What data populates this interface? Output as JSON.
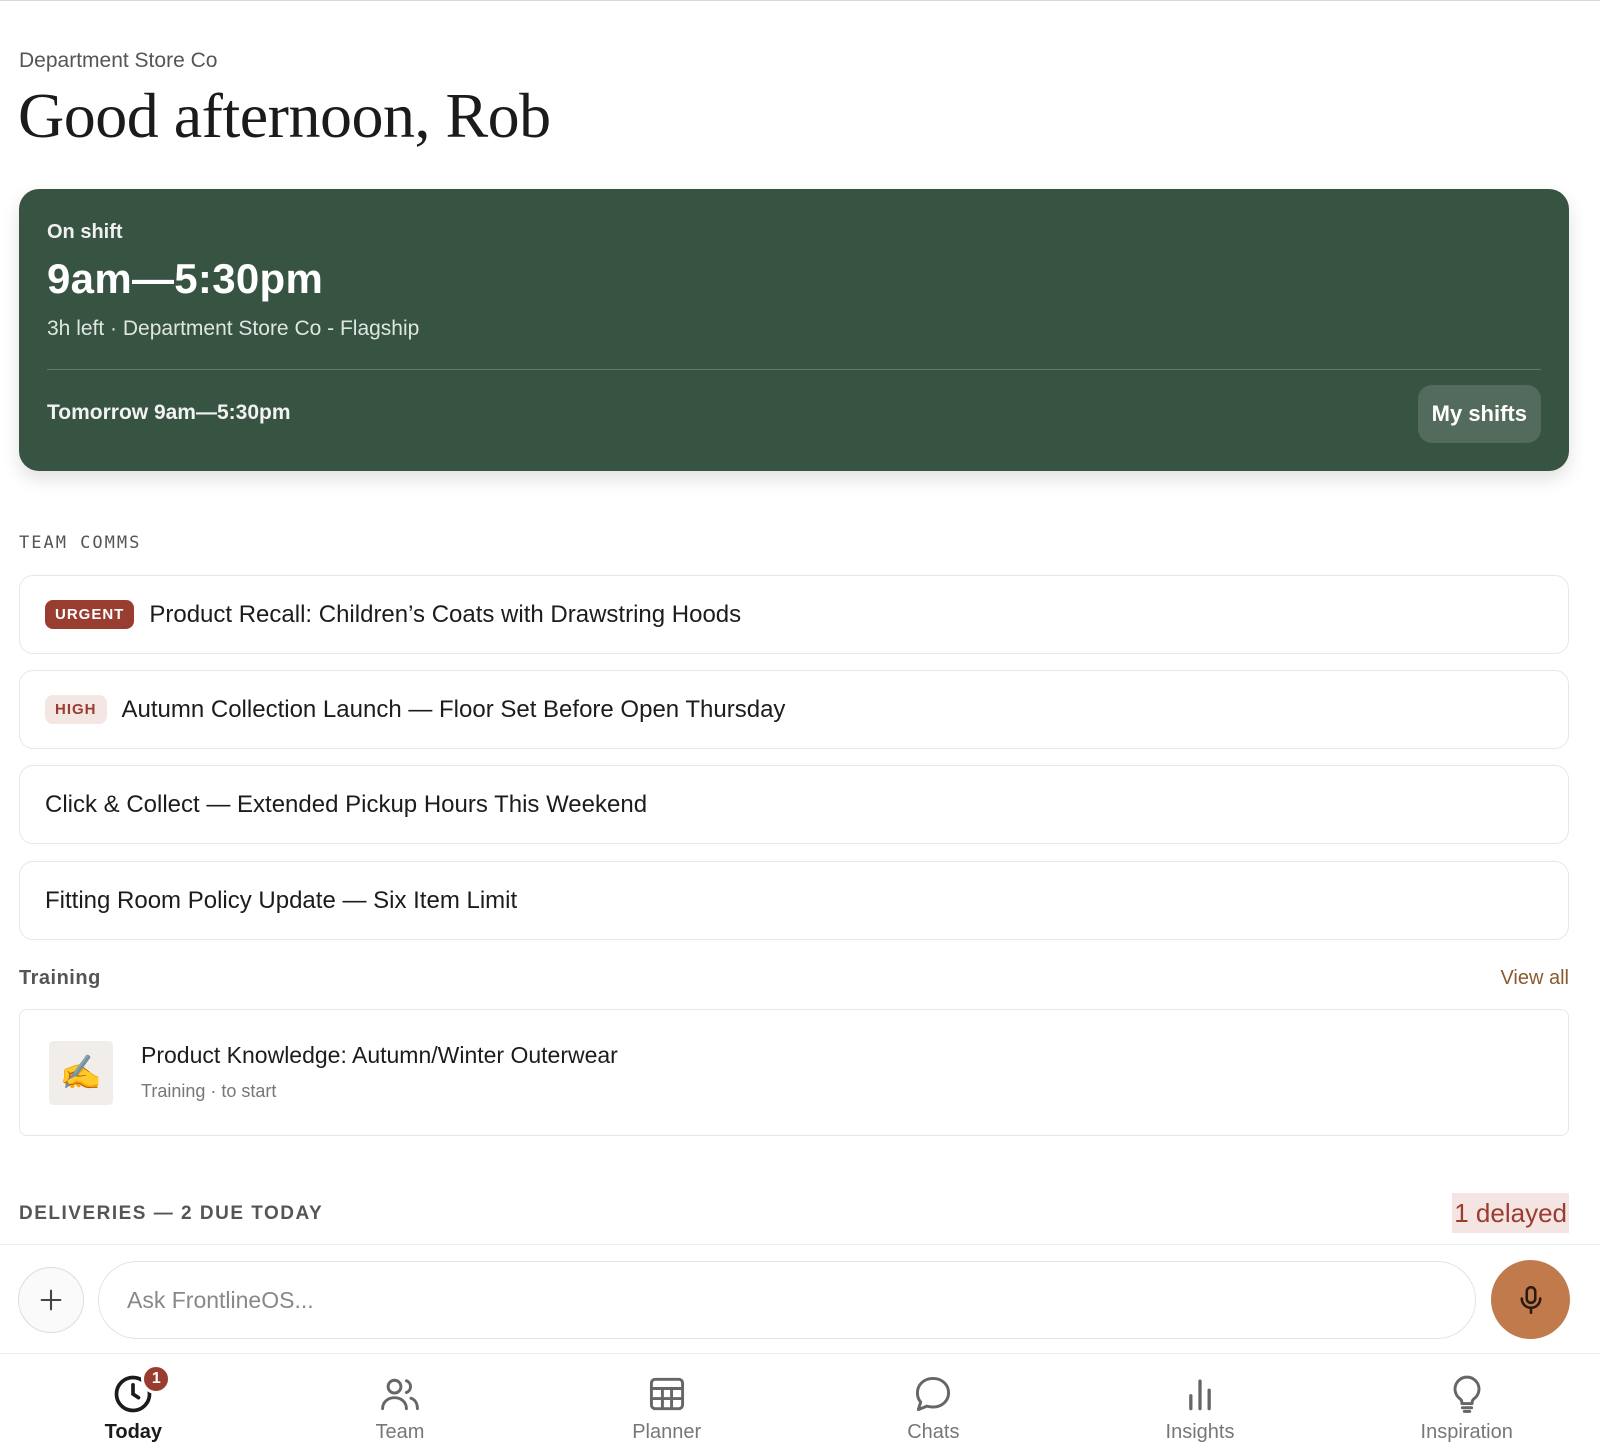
{
  "header": {
    "company": "Department Store Co",
    "greeting": "Good afternoon, Rob"
  },
  "shift": {
    "status": "On shift",
    "time": "9am—5:30pm",
    "meta": "3h left · Department Store Co - Flagship",
    "tomorrow": "Tomorrow 9am—5:30pm",
    "my_shifts_label": "My shifts",
    "accent": "#375342"
  },
  "team_comms": {
    "heading": "TEAM COMMS",
    "items": [
      {
        "badge": "URGENT",
        "title": "Product Recall: Children’s Coats with Drawstring Hoods"
      },
      {
        "badge": "HIGH",
        "title": "Autumn Collection Launch — Floor Set Before Open Thursday"
      },
      {
        "badge": "",
        "title": "Click & Collect — Extended Pickup Hours This Weekend"
      },
      {
        "badge": "",
        "title": "Fitting Room Policy Update — Six Item Limit"
      }
    ],
    "urgent_color": "#9a3d31"
  },
  "training": {
    "heading": "Training",
    "view_all": "View all",
    "item": {
      "icon": "✍️",
      "title": "Product Knowledge: Autumn/Winter Outerwear",
      "subtitle": "Training · to start"
    }
  },
  "deliveries": {
    "heading": "DELIVERIES — 2 DUE TODAY",
    "delayed": "1 delayed"
  },
  "composer": {
    "placeholder": "Ask FrontlineOS...",
    "plus_icon": "plus-icon",
    "mic_icon": "microphone-icon",
    "mic_color": "#c07a4c"
  },
  "tabs": [
    {
      "label": "Today",
      "icon": "clock-icon",
      "badge": "1",
      "active": true
    },
    {
      "label": "Team",
      "icon": "users-icon"
    },
    {
      "label": "Planner",
      "icon": "calendar-grid-icon"
    },
    {
      "label": "Chats",
      "icon": "chat-bubble-icon"
    },
    {
      "label": "Insights",
      "icon": "bar-chart-icon"
    },
    {
      "label": "Inspiration",
      "icon": "lightbulb-icon"
    }
  ]
}
